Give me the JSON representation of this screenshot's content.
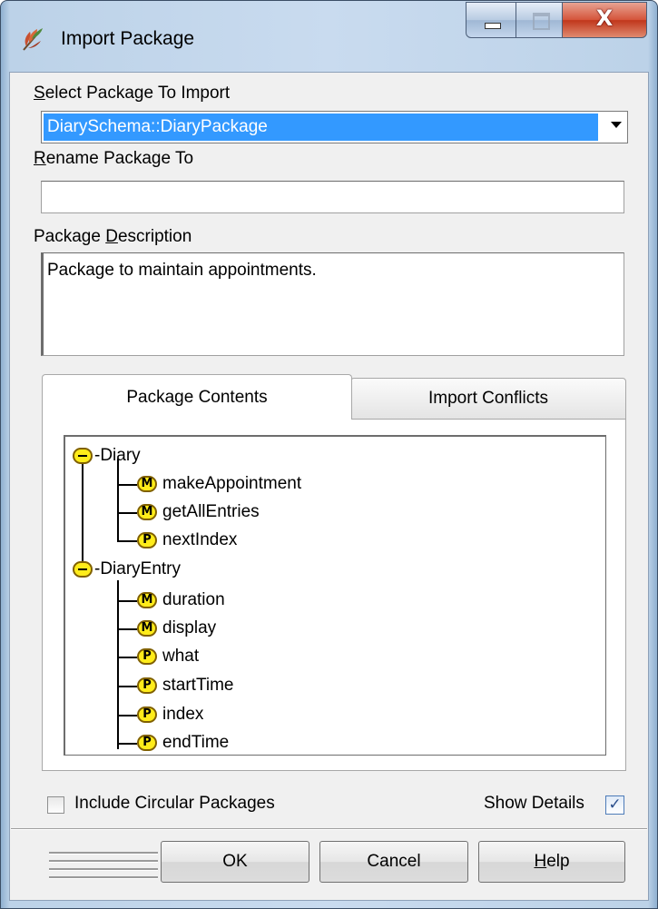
{
  "window": {
    "title": "Import Package",
    "buttons": {
      "minimize": "minimize",
      "maximize": "maximize",
      "close": "X"
    }
  },
  "select_package": {
    "label_prefix": "",
    "label_underlined": "S",
    "label_rest": "elect Package To Import",
    "value": "DiarySchema::DiaryPackage"
  },
  "rename_package": {
    "label_underlined": "R",
    "label_rest": "ename Package To",
    "value": ""
  },
  "description": {
    "label_prefix": "Package ",
    "label_underlined": "D",
    "label_rest": "escription",
    "value": "Package to maintain appointments."
  },
  "tabs": [
    {
      "label": "Package Contents",
      "active": true
    },
    {
      "label": "Import Conflicts",
      "active": false
    }
  ],
  "tree": [
    {
      "type": "group",
      "label": "-Diary",
      "children": [
        {
          "badge": "M",
          "label": "makeAppointment"
        },
        {
          "badge": "M",
          "label": "getAllEntries"
        },
        {
          "badge": "P",
          "label": "nextIndex"
        }
      ]
    },
    {
      "type": "group",
      "label": "-DiaryEntry",
      "children": [
        {
          "badge": "M",
          "label": "duration"
        },
        {
          "badge": "M",
          "label": "display"
        },
        {
          "badge": "P",
          "label": "what"
        },
        {
          "badge": "P",
          "label": "startTime"
        },
        {
          "badge": "P",
          "label": "index"
        },
        {
          "badge": "P",
          "label": "endTime"
        }
      ]
    }
  ],
  "options": {
    "include_circular": {
      "label": "Include Circular Packages",
      "checked": false
    },
    "show_details": {
      "label": "Show Details",
      "checked": true
    }
  },
  "dialog_buttons": {
    "ok": "OK",
    "cancel": "Cancel",
    "help_underlined": "H",
    "help_rest": "elp"
  },
  "colors": {
    "selection": "#3399ff",
    "badge_fill": "#ffec1a",
    "close_button": "#c8452a"
  }
}
